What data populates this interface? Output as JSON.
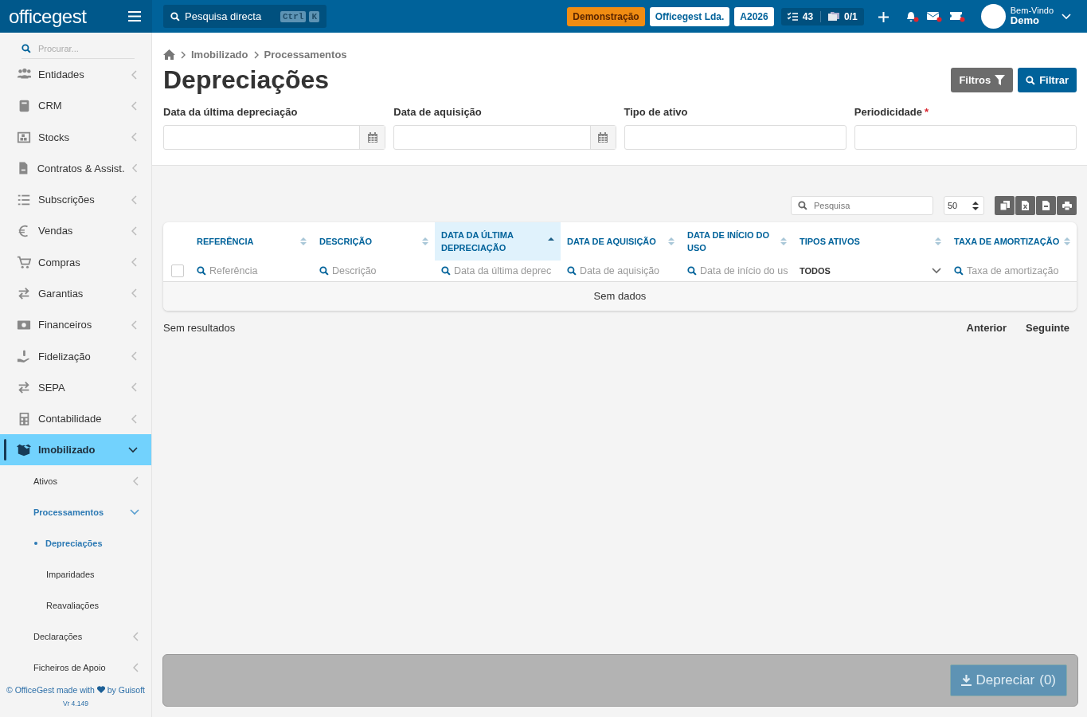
{
  "topbar": {
    "logo": "officegest",
    "search": {
      "placeholder": "Pesquisa directa",
      "keys": [
        "Ctrl",
        "K"
      ]
    },
    "badges": [
      {
        "text": "Demonstração",
        "kind": "warning"
      },
      {
        "text": "Officegest Lda.",
        "kind": "light"
      },
      {
        "text": "A2026",
        "kind": "light"
      }
    ],
    "counters": {
      "tasks": "43",
      "documents": "0/1"
    },
    "user": {
      "greeting": "Bem-Vindo",
      "name": "Demo"
    }
  },
  "sidebar": {
    "search": {
      "placeholder": "Procurar..."
    },
    "items": [
      {
        "label": "Entidades",
        "expanded": false,
        "selected": false
      },
      {
        "label": "CRM",
        "expanded": false,
        "selected": false
      },
      {
        "label": "Stocks",
        "expanded": false,
        "selected": false
      },
      {
        "label": "Contratos & Assist.",
        "expanded": false,
        "selected": false
      },
      {
        "label": "Subscrições",
        "expanded": false,
        "selected": false
      },
      {
        "label": "Vendas",
        "expanded": false,
        "selected": false
      },
      {
        "label": "Compras",
        "expanded": false,
        "selected": false
      },
      {
        "label": "Garantias",
        "expanded": false,
        "selected": false
      },
      {
        "label": "Financeiros",
        "expanded": false,
        "selected": false
      },
      {
        "label": "Fidelização",
        "expanded": false,
        "selected": false
      },
      {
        "label": "SEPA",
        "expanded": false,
        "selected": false
      },
      {
        "label": "Contabilidade",
        "expanded": false,
        "selected": false
      },
      {
        "label": "Imobilizado",
        "expanded": true,
        "selected": true,
        "children": [
          {
            "label": "Ativos",
            "expanded": false,
            "selected": false
          },
          {
            "label": "Processamentos",
            "expanded": true,
            "selected": true,
            "children": [
              {
                "label": "Depreciações",
                "selected": true
              },
              {
                "label": "Imparidades",
                "selected": false
              },
              {
                "label": "Reavaliações",
                "selected": false
              }
            ]
          },
          {
            "label": "Declarações",
            "expanded": false,
            "selected": false
          },
          {
            "label": "Ficheiros de Apoio",
            "expanded": false,
            "selected": false
          }
        ]
      }
    ],
    "footer": {
      "before": "© OfficeGest made with",
      "after": "by Guisoft",
      "version": "Vr 4.149"
    }
  },
  "breadcrumb": [
    "Imobilizado",
    "Processamentos"
  ],
  "title": "Depreciações",
  "required_marker": "*",
  "actions": [
    {
      "label": "Filtros",
      "kind": "secondary"
    },
    {
      "label": "Filtrar",
      "kind": "primary"
    }
  ],
  "filters": [
    {
      "label": "Data da última depreciação",
      "kind": "date",
      "required": false
    },
    {
      "label": "Data de aquisição",
      "kind": "date",
      "required": false
    },
    {
      "label": "Tipo de ativo",
      "kind": "text",
      "required": false
    },
    {
      "label": "Periodicidade",
      "kind": "text",
      "required": true
    }
  ],
  "table": {
    "search": {
      "placeholder": "Pesquisa"
    },
    "page_size": "50",
    "all_checked": false,
    "columns": [
      {
        "label": "REFERÊNCIA",
        "sorted": false,
        "filter": {
          "kind": "text",
          "placeholder": "Referência"
        }
      },
      {
        "label": "DESCRIÇÃO",
        "sorted": false,
        "filter": {
          "kind": "text",
          "placeholder": "Descrição"
        }
      },
      {
        "label": "DATA DA ÚLTIMA DEPRECIAÇÃO",
        "sorted": true,
        "filter": {
          "kind": "text",
          "placeholder": "Data da última deprec"
        }
      },
      {
        "label": "DATA DE AQUISIÇÃO",
        "sorted": false,
        "filter": {
          "kind": "text",
          "placeholder": "Data de aquisição"
        }
      },
      {
        "label": "DATA DE INÍCIO DO USO",
        "sorted": false,
        "filter": {
          "kind": "text",
          "placeholder": "Data de início do us"
        }
      },
      {
        "label": "TIPOS ATIVOS",
        "sorted": false,
        "filter": {
          "kind": "select",
          "value": "TODOS"
        }
      },
      {
        "label": "TAXA DE AMORTIZAÇÃO",
        "sorted": false,
        "filter": {
          "kind": "text",
          "placeholder": "Taxa de amortização"
        }
      }
    ],
    "empty": "Sem dados",
    "info": "Sem resultados",
    "pager": [
      "Anterior",
      "Seguinte"
    ]
  },
  "submit": {
    "label": "Depreciar",
    "count": "(0)",
    "disabled": true
  }
}
